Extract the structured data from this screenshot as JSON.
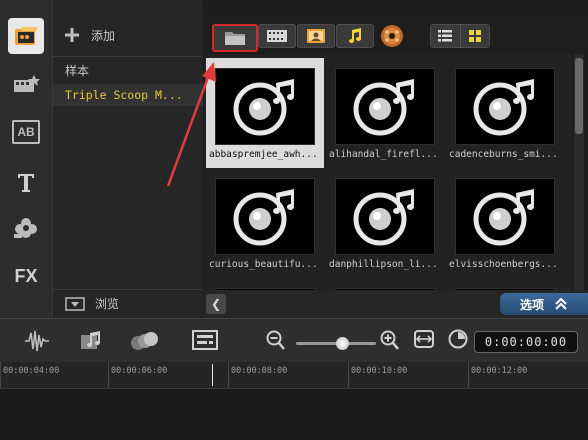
{
  "sidebar": {
    "add_label": "添加",
    "items": [
      {
        "label": "样本",
        "selected": false
      },
      {
        "label": "Triple Scoop M...",
        "selected": true
      }
    ],
    "browse_label": "浏览"
  },
  "left_tools": [
    "media-icon",
    "instant-project-icon",
    "title-icon",
    "text-icon",
    "graphics-icon",
    "filter-fx-icon"
  ],
  "left_tool_labels": {
    "title": "AB",
    "fx": "FX"
  },
  "library_toolbar": {
    "buttons": [
      "folder-icon",
      "video-icon",
      "photo-icon",
      "audio-icon",
      "audio-cd-icon"
    ],
    "view_buttons": [
      "list-view-icon",
      "grid-view-icon"
    ]
  },
  "media_items": [
    {
      "label": "abbaspremjee_awh...",
      "selected": true
    },
    {
      "label": "alihandal_firefl...",
      "selected": false
    },
    {
      "label": "cadenceburns_smi...",
      "selected": false
    },
    {
      "label": "curious_beautifu...",
      "selected": false
    },
    {
      "label": "danphillipson_li...",
      "selected": false
    },
    {
      "label": "elvisschoenbergs...",
      "selected": false
    },
    {
      "label": "",
      "selected": false
    },
    {
      "label": "",
      "selected": false
    },
    {
      "label": "",
      "selected": false
    }
  ],
  "library_bottom": {
    "options_label": "选项"
  },
  "timeline": {
    "timecode": "0:00:00:00",
    "ruler_labels": [
      "00:00:04:00",
      "00:00:06:00",
      "00:00:08:00",
      "00:00:10:00",
      "00:00:12:00"
    ]
  },
  "colors": {
    "highlight": "#d62a2a",
    "selected_text": "#e9c83a",
    "options_button": "#2f5c88"
  }
}
